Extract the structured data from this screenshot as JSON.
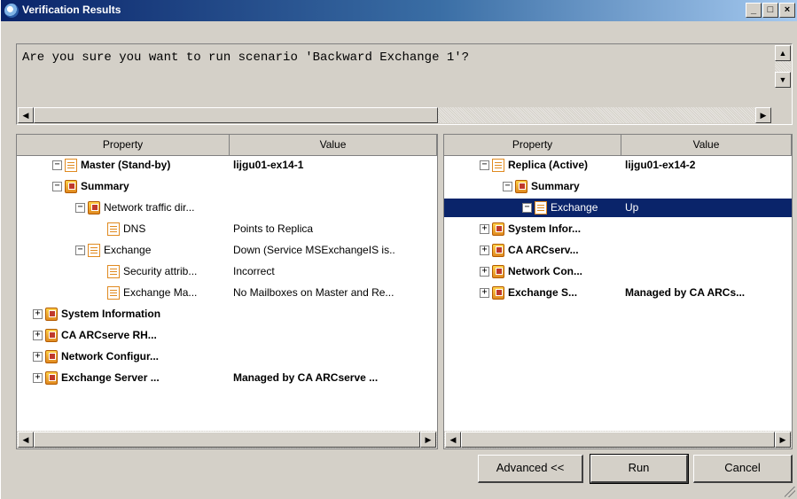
{
  "window": {
    "title": "Verification Results",
    "minimize": "_",
    "maximize": "□",
    "close": "×"
  },
  "message": "Are you sure you want to run scenario 'Backward Exchange 1'?",
  "left_pane": {
    "headers": [
      "Property",
      "Value"
    ],
    "rows": [
      {
        "label": "Master (Stand-by)",
        "value": "lijgu01-ex14-1",
        "bold": true,
        "expander": "−",
        "icon": "doc-icon"
      },
      {
        "label": "Summary",
        "value": "",
        "bold": true,
        "expander": "−",
        "icon": "group-icon"
      },
      {
        "label": "Network traffic dir...",
        "value": "",
        "bold": false,
        "expander": "−",
        "icon": "group-icon"
      },
      {
        "label": "DNS",
        "value": "Points to Replica",
        "bold": false,
        "expander": "",
        "icon": "doc-icon"
      },
      {
        "label": "Exchange",
        "value": "Down (Service MSExchangeIS is..",
        "bold": false,
        "expander": "−",
        "icon": "doc-icon"
      },
      {
        "label": "Security attrib...",
        "value": "Incorrect",
        "bold": false,
        "expander": "",
        "icon": "doc-icon"
      },
      {
        "label": "Exchange Ma...",
        "value": "No Mailboxes on Master and Re...",
        "bold": false,
        "expander": "",
        "icon": "doc-icon"
      },
      {
        "label": "System Information",
        "value": "",
        "bold": true,
        "expander": "+",
        "icon": "group-icon"
      },
      {
        "label": "CA ARCserve RH...",
        "value": "",
        "bold": true,
        "expander": "+",
        "icon": "group-icon"
      },
      {
        "label": "Network Configur...",
        "value": "",
        "bold": true,
        "expander": "+",
        "icon": "group-icon"
      },
      {
        "label": "Exchange Server ...",
        "value": "Managed by CA ARCserve ...",
        "bold": true,
        "expander": "+",
        "icon": "group-icon"
      }
    ]
  },
  "right_pane": {
    "headers": [
      "Property",
      "Value"
    ],
    "rows": [
      {
        "label": "Replica (Active)",
        "value": "lijgu01-ex14-2",
        "bold": true,
        "expander": "−",
        "icon": "doc-icon"
      },
      {
        "label": "Summary",
        "value": "",
        "bold": true,
        "expander": "−",
        "icon": "group-icon"
      },
      {
        "label": "Exchange",
        "value": "Up",
        "bold": false,
        "expander": "−",
        "icon": "doc-icon",
        "selected": true
      },
      {
        "label": "System Infor...",
        "value": "",
        "bold": true,
        "expander": "+",
        "icon": "group-icon"
      },
      {
        "label": "CA ARCserv...",
        "value": "",
        "bold": true,
        "expander": "+",
        "icon": "group-icon"
      },
      {
        "label": "Network Con...",
        "value": "",
        "bold": true,
        "expander": "+",
        "icon": "group-icon"
      },
      {
        "label": "Exchange S...",
        "value": "Managed by CA ARCs...",
        "bold": true,
        "expander": "+",
        "icon": "group-icon"
      }
    ]
  },
  "buttons": {
    "advanced": "Advanced <<",
    "run": "Run",
    "cancel": "Cancel"
  }
}
